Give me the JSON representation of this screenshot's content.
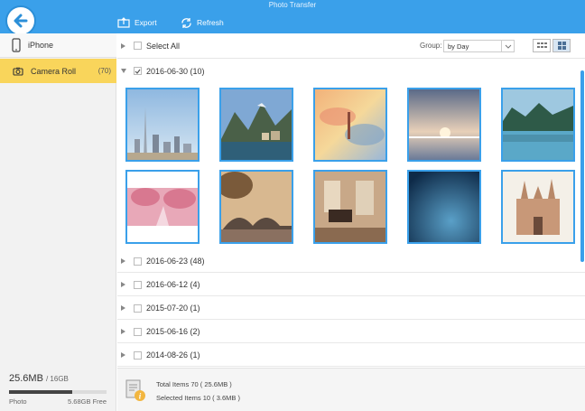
{
  "window": {
    "title": "Photo Transfer"
  },
  "toolbar": {
    "export_label": "Export",
    "refresh_label": "Refresh"
  },
  "sidebar": {
    "device": {
      "label": "iPhone"
    },
    "camera_roll": {
      "label": "Camera Roll",
      "count": "(70)"
    },
    "storage": {
      "used": "25.6MB",
      "total": "/ 16GB",
      "kind": "Photo",
      "free": "5.68GB Free",
      "used_fraction": 0.65
    }
  },
  "content": {
    "select_all": "Select All",
    "group_label": "Group:",
    "group_value": "by Day",
    "expanded_group": "2016-06-30 (10)",
    "collapsed_groups": [
      "2016-06-23 (48)",
      "2016-06-12 (4)",
      "2015-07-20 (1)",
      "2015-06-16 (2)",
      "2014-08-26 (1)"
    ]
  },
  "footer": {
    "total": "Total Items 70 ( 25.6MB )",
    "selected": "Selected Items 10 ( 3.6MB )"
  }
}
